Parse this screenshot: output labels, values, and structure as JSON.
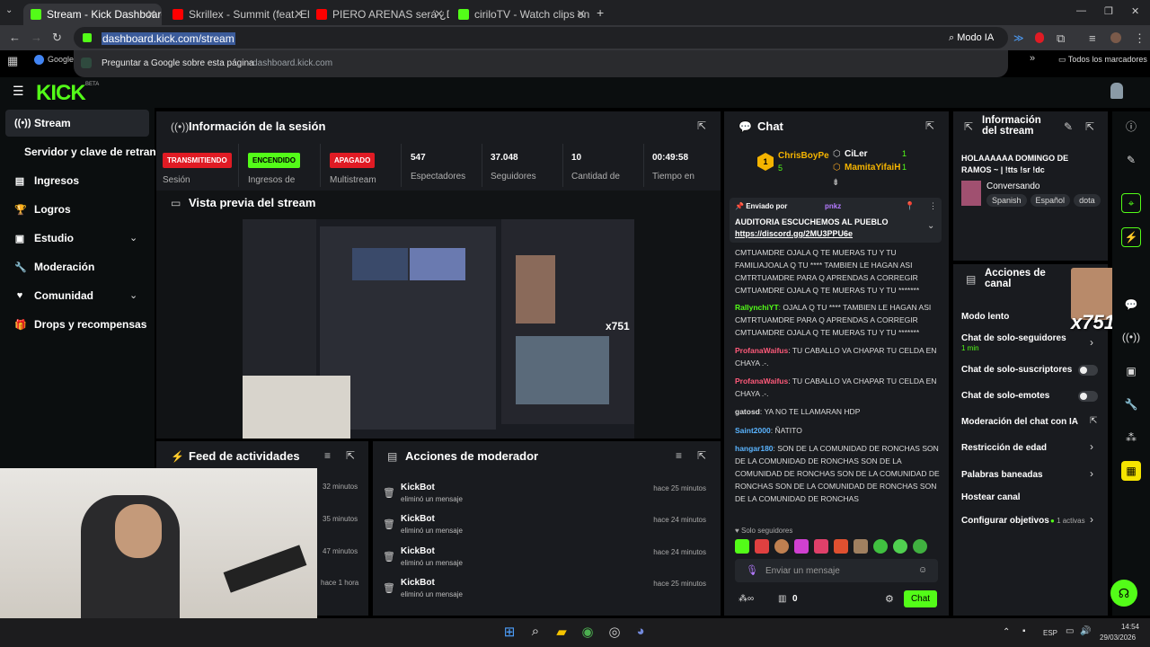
{
  "browser": {
    "tabs": [
      {
        "title": "Stream - Kick Dashboard",
        "active": true,
        "favicon_color": "#53fc18"
      },
      {
        "title": "Skrillex - Summit (feat. Ellie Go",
        "active": false,
        "favicon_color": "#ff0000"
      },
      {
        "title": "PIERO ARENAS será ¿DENU",
        "active": false,
        "favicon_color": "#ff0000"
      },
      {
        "title": "ciriloTV - Watch clips on Kick",
        "active": false,
        "favicon_color": "#53fc18"
      }
    ],
    "url": "dashboard.kick.com/stream",
    "ai_mode": "Modo IA",
    "suggestion_text": "Preguntar a Google sobre esta página",
    "suggestion_url": "- dashboard.kick.com",
    "bookmark_google": "Google",
    "all_bookmarks": "Todos los marcadores"
  },
  "kick": {
    "logo": "KICK",
    "beta": "BETA",
    "accent": "#53fc18",
    "nav": [
      {
        "label": "Stream",
        "icon": "broadcast-icon",
        "active": true
      },
      {
        "label": "Servidor y clave de retransn",
        "icon": "",
        "active": false
      },
      {
        "label": "Ingresos",
        "icon": "revenue-icon",
        "active": false
      },
      {
        "label": "Logros",
        "icon": "trophy-icon",
        "active": false
      },
      {
        "label": "Estudio",
        "icon": "studio-icon",
        "active": false,
        "chevron": true
      },
      {
        "label": "Moderación",
        "icon": "wrench-icon",
        "active": false
      },
      {
        "label": "Comunidad",
        "icon": "heart-icon",
        "active": false,
        "chevron": true
      },
      {
        "label": "Drops y recompensas",
        "icon": "gift-icon",
        "active": false
      }
    ],
    "session": {
      "title": "Información de la sesión",
      "badges": [
        {
          "text": "TRANSMITIENDO",
          "label": "Sesión",
          "color": "#e01b24"
        },
        {
          "text": "ENCENDIDO",
          "label": "Ingresos de",
          "color": "#53fc18"
        },
        {
          "text": "APAGADO",
          "label": "Multistream",
          "color": "#e01b24"
        }
      ],
      "stats": [
        {
          "value": "547",
          "label": "Espectadores"
        },
        {
          "value": "37.048",
          "label": "Seguidores"
        },
        {
          "value": "10",
          "label": "Cantidad de"
        },
        {
          "value": "00:49:58",
          "label": "Tiempo en"
        }
      ]
    },
    "preview": {
      "title": "Vista previa del stream",
      "overlay_count": "x751"
    },
    "activity": {
      "title": "Feed de actividades",
      "times": [
        "32 minutos",
        "35 minutos",
        "47 minutos",
        "hace 1 hora"
      ]
    },
    "modactions": {
      "title": "Acciones de moderador",
      "rows": [
        {
          "user": "KickBot",
          "action": "eliminó un mensaje",
          "time": "hace 25 minutos"
        },
        {
          "user": "KickBot",
          "action": "eliminó un mensaje",
          "time": "hace 24 minutos"
        },
        {
          "user": "KickBot",
          "action": "eliminó un mensaje",
          "time": "hace 24 minutos"
        },
        {
          "user": "KickBot",
          "action": "eliminó un mensaje",
          "time": "hace 25 minutos"
        }
      ]
    },
    "chat": {
      "title": "Chat",
      "leaders": [
        {
          "name": "ChrisBoyPe",
          "count": "5"
        },
        {
          "name": "CiLer",
          "count": "1"
        },
        {
          "name": "MamitaYifaiH",
          "count": "1"
        }
      ],
      "pinned_by_label": "Enviado por",
      "pinned_by_user": "pnkz",
      "pinned_text": "AUDITORIA ESCUCHEMOS AL PUEBLO",
      "pinned_link": "https://discord.gg/2MU3PPU6e",
      "messages": [
        {
          "user": "",
          "color": "#ddd",
          "text": "CMTUAMDRE OJALA Q TE MUERAS TU Y TU FAMILIAJOALA Q TU **** TAMBIEN LE HAGAN ASI CMTRTUAMDRE PARA Q APRENDAS A CORREGIR CMTUAMDRE OJALA Q TE MUERAS TU Y TU *******"
        },
        {
          "user": "RallynchiYT",
          "color": "#53fc18",
          "text": "OJALA Q TU **** TAMBIEN LE HAGAN ASI CMTRTUAMDRE PARA Q APRENDAS A CORREGIR CMTUAMDRE OJALA Q TE MUERAS TU Y TU *******"
        },
        {
          "user": "ProfanaWaifus",
          "color": "#ff5a7a",
          "text": "TU CABALLO VA CHAPAR TU CELDA EN CHAYA .-."
        },
        {
          "user": "ProfanaWaifus",
          "color": "#ff5a7a",
          "text": "TU CABALLO VA CHAPAR TU CELDA EN CHAYA .-."
        },
        {
          "user": "gatosd",
          "color": "#dddddd",
          "text": "YA NO TE LLAMARAN HDP"
        },
        {
          "user": "Saint2000",
          "color": "#5ab4ff",
          "text": "ÑATITO"
        },
        {
          "user": "hangar180",
          "color": "#5ab4ff",
          "text": "SON DE LA COMUNIDAD DE RONCHAS SON DE LA COMUNIDAD DE RONCHAS SON DE LA COMUNIDAD DE RONCHAS SON DE LA COMUNIDAD DE RONCHAS SON DE LA COMUNIDAD DE RONCHAS SON DE LA COMUNIDAD DE RONCHAS"
        }
      ],
      "followers_only": "Solo seguidores",
      "input_placeholder": "Enviar un mensaje",
      "points": "0",
      "send_label": "Chat"
    },
    "stream_info": {
      "title": "Información del stream",
      "stream_title": "HOLAAAAAA DOMINGO DE RAMOS ~ | !tts !sr !dc",
      "category": "Conversando",
      "tags": [
        "Spanish",
        "Español",
        "dota"
      ]
    },
    "channel_actions": {
      "title": "Acciones de canal",
      "rows": [
        {
          "label": "Modo lento",
          "control": "none"
        },
        {
          "label": "Chat de solo-seguidores",
          "sub": "1 min",
          "control": "arrow"
        },
        {
          "label": "Chat de solo-suscriptores",
          "control": "toggle"
        },
        {
          "label": "Chat de solo-emotes",
          "control": "toggle"
        },
        {
          "label": "Moderación del chat con IA",
          "control": "external"
        },
        {
          "label": "Restricción de edad",
          "control": "arrow"
        },
        {
          "label": "Palabras baneadas",
          "control": "arrow"
        },
        {
          "label": "Hostear canal",
          "control": "none"
        },
        {
          "label": "Configurar objetivos",
          "sub": "1 activas",
          "control": "arrow"
        }
      ]
    }
  },
  "taskbar": {
    "lang": "ESP",
    "time": "14:54",
    "date": "29/03/2026"
  }
}
